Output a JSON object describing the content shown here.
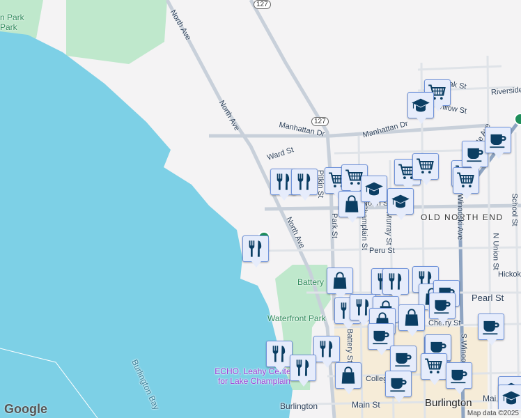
{
  "labels": {
    "park_top_left": "n Park",
    "park_top_left2": "Park",
    "north_ave_1": "North Ave",
    "north_ave_2": "North Ave",
    "north_ave_3": "North Ave",
    "route_127a": "127",
    "route_127b": "127",
    "manhattan_1": "Manhattan Dr",
    "manhattan_2": "Manhattan Dr",
    "ward_st": "Ward St",
    "oak_st": "Oak St",
    "willow_st": "Willow St",
    "riverside": "Riverside",
    "intervale_ave": "Intervale Ave",
    "pitkin_st": "Pitkin St",
    "park_st": "Park St",
    "champlain_st": "Champlain St",
    "murray_st": "Murray St",
    "north_st": "North St",
    "old_north_end": "OLD NORTH END",
    "school_st": "School St",
    "n_union_st": "N Union St",
    "n_winooski_ave": "N Winooski Ave",
    "peru_st": "Peru St",
    "hickok": "Hickok",
    "pearl_st": "Pearl St",
    "cherry_st": "Cherry St",
    "s_winooski": "S Winooski",
    "battery_park": "Battery",
    "waterfront_park": "Waterfront Park",
    "echo": "ECHO, Leahy Center for Lake Champlain",
    "burlington_bay": "Burlington Bay",
    "burlington_station": "Burlington",
    "main_st": "Main St",
    "main_st2": "Mai",
    "college_st": "College St",
    "burlington_city": "Burlington",
    "battery_st": "Battery St"
  },
  "markers": [
    {
      "type": "grocery-cart"
    },
    {
      "type": "school"
    },
    {
      "type": "restaurant"
    },
    {
      "type": "restaurant"
    },
    {
      "type": "grocery-cart"
    },
    {
      "type": "grocery-cart"
    },
    {
      "type": "shopping-bag"
    },
    {
      "type": "school"
    },
    {
      "type": "grocery-cart"
    },
    {
      "type": "grocery-cart"
    },
    {
      "type": "school"
    },
    {
      "type": "grocery-cart"
    },
    {
      "type": "grocery-cart"
    },
    {
      "type": "cafe"
    },
    {
      "type": "cafe"
    },
    {
      "type": "restaurant"
    },
    {
      "type": "shopping-bag"
    },
    {
      "type": "restaurant"
    },
    {
      "type": "restaurant"
    },
    {
      "type": "restaurant"
    },
    {
      "type": "shopping-bag"
    },
    {
      "type": "cafe"
    },
    {
      "type": "cafe"
    },
    {
      "type": "restaurant"
    },
    {
      "type": "restaurant"
    },
    {
      "type": "shopping-bag"
    },
    {
      "type": "shopping-bag"
    },
    {
      "type": "cafe"
    },
    {
      "type": "shopping-bag"
    },
    {
      "type": "cafe"
    },
    {
      "type": "grocery-cart"
    },
    {
      "type": "cafe"
    },
    {
      "type": "cafe"
    },
    {
      "type": "grocery-cart"
    },
    {
      "type": "cafe"
    },
    {
      "type": "cafe"
    },
    {
      "type": "restaurant"
    },
    {
      "type": "restaurant"
    },
    {
      "type": "restaurant"
    },
    {
      "type": "shopping-bag"
    },
    {
      "type": "school"
    },
    {
      "type": "school"
    }
  ],
  "footer": {
    "logo": "Google",
    "attribution": "Map data ©2025"
  },
  "colors": {
    "water": "#7dd0e6",
    "park": "#bfe8cc",
    "land": "#f4f3f4",
    "marker_bg": "#e6ecfb",
    "marker_border": "#6f93da",
    "icon": "#0b3e63",
    "downtown": "#f6ecd8"
  }
}
